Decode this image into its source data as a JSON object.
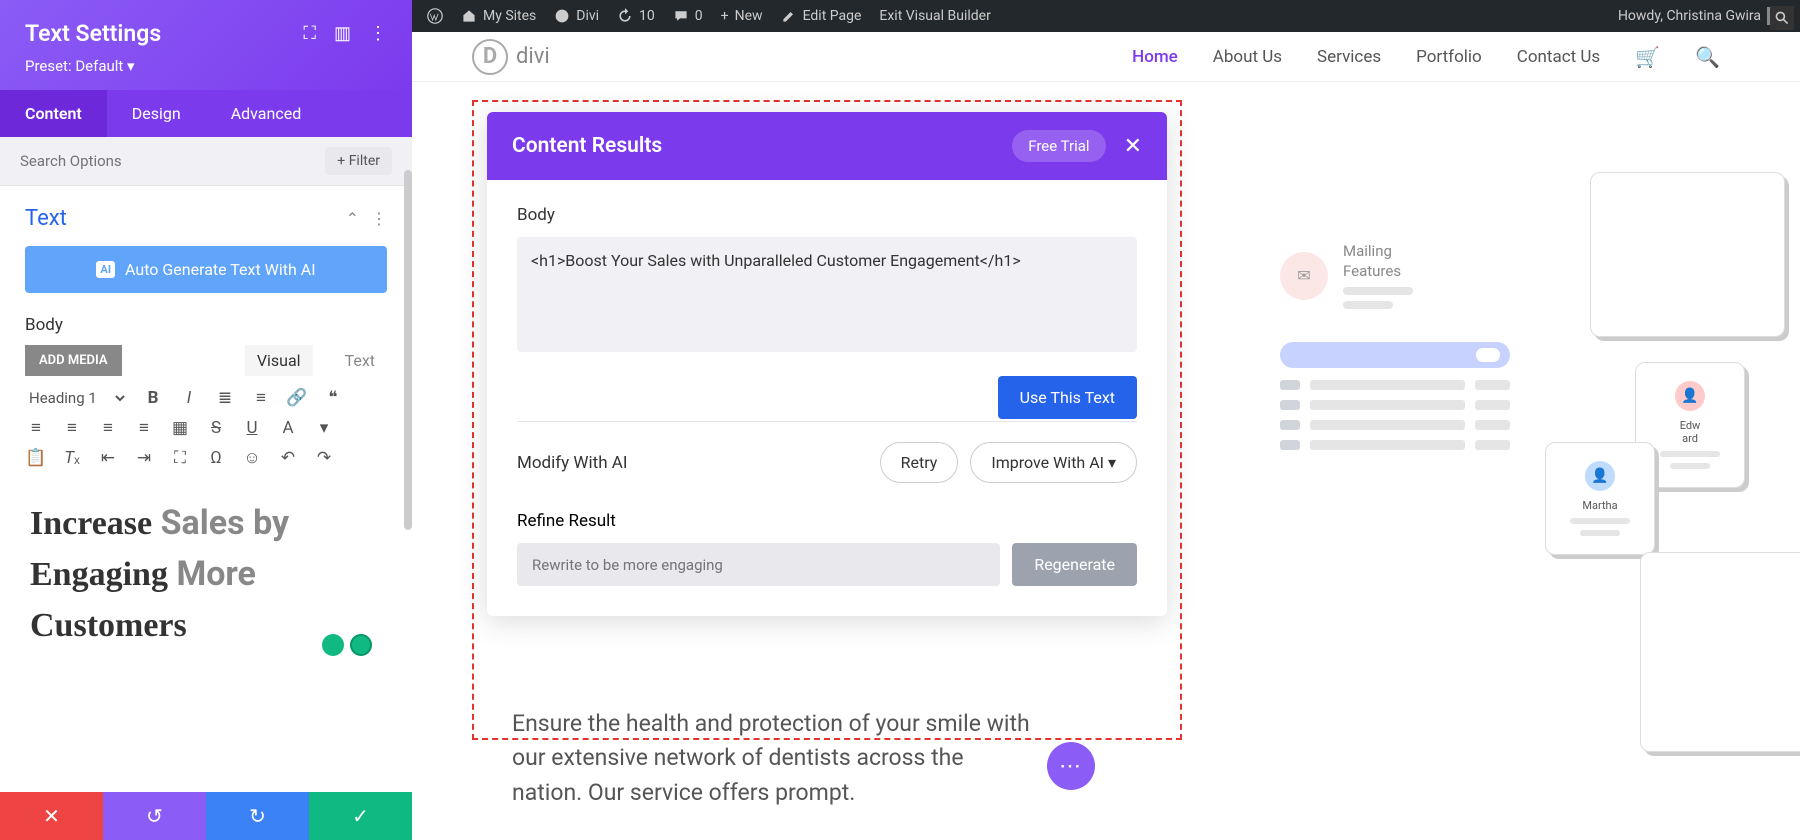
{
  "sidebar": {
    "title": "Text Settings",
    "preset": "Preset: Default ▾",
    "tabs": [
      "Content",
      "Design",
      "Advanced"
    ],
    "search_placeholder": "Search Options",
    "filter_label": "+ Filter",
    "section_label": "Text",
    "auto_gen_label": "Auto Generate Text With AI",
    "body_label": "Body",
    "add_media": "ADD MEDIA",
    "visual_tab": "Visual",
    "text_tab": "Text",
    "heading_select": "Heading 1",
    "editor_html": "Increase <span class='gray'>Sales</span> <span class='gray'>by</span> Engaging <span class='gray'>More</span> Customers"
  },
  "wpbar": {
    "mysites": "My Sites",
    "divi": "Divi",
    "updates": "10",
    "comments": "0",
    "new": "New",
    "edit": "Edit Page",
    "exit": "Exit Visual Builder",
    "howdy": "Howdy, Christina Gwira"
  },
  "nav": {
    "logo": "divi",
    "items": [
      "Home",
      "About Us",
      "Services",
      "Portfolio",
      "Contact Us"
    ]
  },
  "modal": {
    "title": "Content Results",
    "free_trial": "Free Trial",
    "body_label": "Body",
    "body_text": "<h1>Boost Your Sales with Unparalleled Customer Engagement</h1>",
    "use_btn": "Use This Text",
    "modify_label": "Modify With AI",
    "retry": "Retry",
    "improve": "Improve With AI  ▾",
    "refine_label": "Refine Result",
    "refine_placeholder": "Rewrite to be more engaging",
    "regen": "Regenerate"
  },
  "bg_text": "Ensure the health and protection of your smile with our extensive network of dentists across the nation. Our service offers prompt.",
  "deco": {
    "mailing": "Mailing\nFeatures",
    "p1": "Edw\nard",
    "p2": "Martha"
  }
}
